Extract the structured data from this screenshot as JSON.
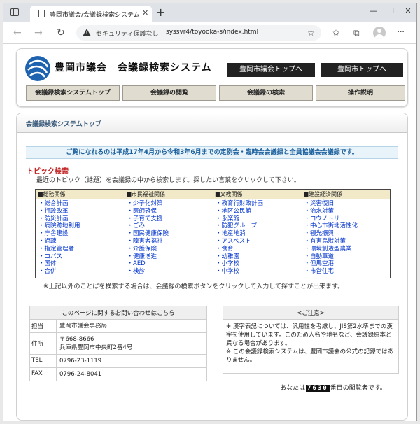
{
  "browser": {
    "tab_title": "豊岡市議会/会議録検索システム",
    "security_label": "セキュリティ保護なし",
    "url": "syssvr4/toyooka-s/index.html"
  },
  "header": {
    "site_title": "豊岡市議会　会議録検索システム",
    "buttons": [
      "豊岡市議会トップへ",
      "豊岡市トップへ"
    ],
    "nav": [
      "会議録検索システムトップ",
      "会議録の閲覧",
      "会議録の検索",
      "操作説明"
    ]
  },
  "main": {
    "section_title": "会議録検索システムトップ",
    "notice": "ご覧になれるのは平成17年4月から令和3年6月までの定例会・臨時会会議録と全員協議会会議録です。",
    "topic_title": "トピック検索",
    "topic_desc": "最近のトピック（話題）を会議録の中から検索します。探したい言葉をクリックして下さい。",
    "topic_columns": [
      {
        "head": "■総務関係",
        "items": [
          "総合計画",
          "行政改革",
          "防災計画",
          "病院跡地利用",
          "庁舎建設",
          "過疎",
          "指定管理者",
          "コバス",
          "国体",
          "合併"
        ]
      },
      {
        "head": "■市民福祉関係",
        "items": [
          "少子化対策",
          "医師確保",
          "子育て支援",
          "ごみ",
          "国民健康保険",
          "障害者福祉",
          "介護保険",
          "健康増進",
          "AED",
          "検診"
        ]
      },
      {
        "head": "■文教関係",
        "items": [
          "教育行財政計画",
          "地区公民館",
          "永楽館",
          "防犯グループ",
          "地産地消",
          "アスベスト",
          "食育",
          "幼稚園",
          "小学校",
          "中学校"
        ]
      },
      {
        "head": "■建設経済関係",
        "items": [
          "災害復旧",
          "治水対策",
          "コウノトリ",
          "中心市街地活性化",
          "観光振興",
          "有害鳥獣対策",
          "環境創造型農業",
          "自動車道",
          "但馬空港",
          "市営住宅"
        ]
      }
    ],
    "topic_note": "※上記以外のことばを検索する場合は、会議録の検索ボタンをクリックして入力して探すことが出来ます。",
    "contact": {
      "head": "このページに関するお問い合わせはこちら",
      "rows": [
        {
          "label": "担当",
          "value": "豊岡市議会事務局"
        },
        {
          "label": "住所",
          "value": "〒668-8666\n兵庫県豊岡市中央町2番4号"
        },
        {
          "label": "TEL",
          "value": "0796-23-1119"
        },
        {
          "label": "FAX",
          "value": "0796-24-8041"
        }
      ]
    },
    "caution": {
      "head": "<ご注意>",
      "lines": [
        "※ 漢字表記については、汎用性を考慮し、JIS第2水準までの漢字を使用しています。このため人名や地名など、会議録原本と異なる場合があります。",
        "※ この会議録検索システムは、豊岡市議会の公式の記録ではありません。"
      ]
    },
    "counter": {
      "prefix": "あなたは",
      "digits": "7630",
      "suffix": "番目の閲覧者です。"
    }
  }
}
